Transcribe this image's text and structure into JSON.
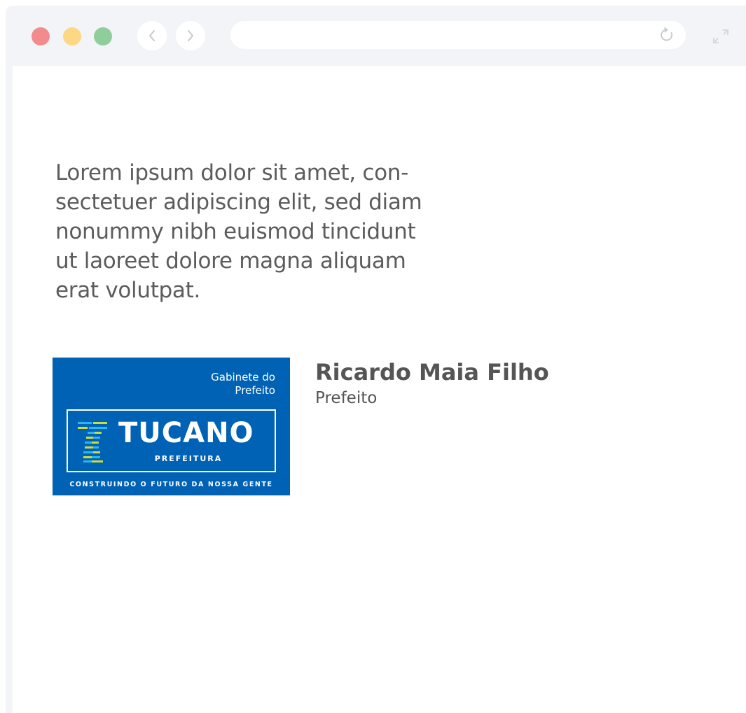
{
  "browser": {
    "controls": [
      "close",
      "minimize",
      "maximize"
    ],
    "nav_back_icon": "chevron-left-icon",
    "nav_forward_icon": "chevron-right-icon",
    "address": "",
    "reload_icon": "reload-icon",
    "expand_icon": "expand-icon"
  },
  "content": {
    "paragraph": "Lorem ipsum dolor sit amet, con- sectetuer adipiscing elit, sed diam nonummy nibh euismod tincidunt ut laoreet dolore magna aliquam erat volutpat.",
    "paragraph_lines": [
      "Lorem ipsum dolor sit amet, con-",
      "sectetuer adipiscing elit, sed diam",
      "nonummy nibh euismod tincidunt",
      "ut laoreet dolore magna aliquam",
      "erat volutpat."
    ],
    "logo": {
      "office_line1": "Gabinete do",
      "office_line2": "Prefeito",
      "name": "TUCANO",
      "subtitle": "PREFEITURA",
      "tagline": "CONSTRUINDO O FUTURO DA NOSSA GENTE",
      "background": "#0062b5",
      "accent_yellow": "#cddc39",
      "accent_cyan": "#29b6f6"
    },
    "person": {
      "name": "Ricardo Maia Filho",
      "role": "Prefeito"
    }
  }
}
